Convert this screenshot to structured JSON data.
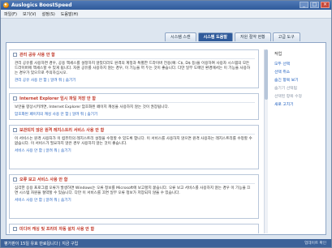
{
  "window": {
    "title": "Auslogics BoostSpeed",
    "minimize": "_",
    "maximize": "□",
    "close": "×"
  },
  "menu": [
    "파일(F)",
    "보기(V)",
    "설정(S)",
    "도움말(H)"
  ],
  "tabs": [
    "시스템 스캔",
    "시스템 도움말",
    "자원 절약 현황",
    "고급 도구"
  ],
  "cards": [
    {
      "title": "관리 공유 사용 안 함",
      "title_color": "red",
      "body": "관리 공유를 사용하면 경우, 공용 액세스를 설정하지 않았더라도 원격의 계정과 특별한 드라이버 전용(예: C$, D$ 등)을 이용하여 사용자 시스템의 모든 드라이버에 액세스할 수 있게 됩니다. 자원 공유를 사용하지 않는 경우, 이 기능을 꺼 두는 것이 좋습니다. 다만 일부 도메인 환경에서는 이 기능을 사용하는 경우가 있으므로 주의하십시오.",
      "links": "관리 공유 사용 안 함 | 알려 줘 | 숨기기"
    },
    {
      "title": "Internet Explorer 임시 파일 저장 안 함",
      "title_color": "red",
      "body": "보안을 향상시키려면, Internet Explorer 암호화된 페이지 캐싱을 사용하지 않는 것이 권장됩니다.",
      "links": "암호화된 페이지의 캐싱 사용 안 함 | 알려 줘 | 숨기기"
    },
    {
      "title": "보관되지 않은 원격 레지스트리 서비스 사용 안 함",
      "title_color": "red",
      "body": "이 서비스는 원격 사용자가 이 컴퓨터의 레지스트리 설정을 수정할 수 있도록 합니다. 이 서비스를 사용하지 않으면 원격 사용자는 레지스트리를 수정할 수 없습니다. 이 서비스가 필요하지 않은 경우 사용하지 않는 것이 좋습니다.",
      "links": "서비스 사용 안 함 | 알려 줘 | 숨기기"
    },
    {
      "title": "오류 보고 서비스 사용 안 함",
      "title_color": "red",
      "body": "심각한 응용 프로그램 오류가 발생하면 Windows는 오류 정보를 Microsoft에 보고할지 묻습니다. 오류 보고 서비스를 사용하지 않는 경우 이 기능을 끄면 시스템 자원을 절약할 수 있습니다. 다만 이 서비스를 끄면 일부 오류 정보가 저장되지 않을 수 있습니다.",
      "links": "서비스 사용 안 함 | 알려 줘 | 숨기기"
    },
    {
      "title": "미디어 캐싱 및 프리미 자동 설치 사용 안 함",
      "title_color": "red",
      "body": "",
      "links": ""
    }
  ],
  "side": {
    "heading": "작업",
    "items": [
      {
        "label": "모두 선택",
        "dim": false
      },
      {
        "label": "선택 취소",
        "dim": false
      },
      {
        "label": "숨긴 항목 보기",
        "dim": false
      },
      {
        "label": "숨기기 선택됨",
        "dim": true
      },
      {
        "label": "선택된 항목 수정",
        "dim": true
      },
      {
        "label": "새로 고치기",
        "dim": false
      }
    ]
  },
  "status": {
    "left": "평가판이 15일 유효 만료됩니다 | 지금 구입",
    "right": "업데이트 확인"
  },
  "colors": {
    "accent": "#2f5a9a",
    "title_red": "#c0392b",
    "link": "#1f5fbf"
  }
}
